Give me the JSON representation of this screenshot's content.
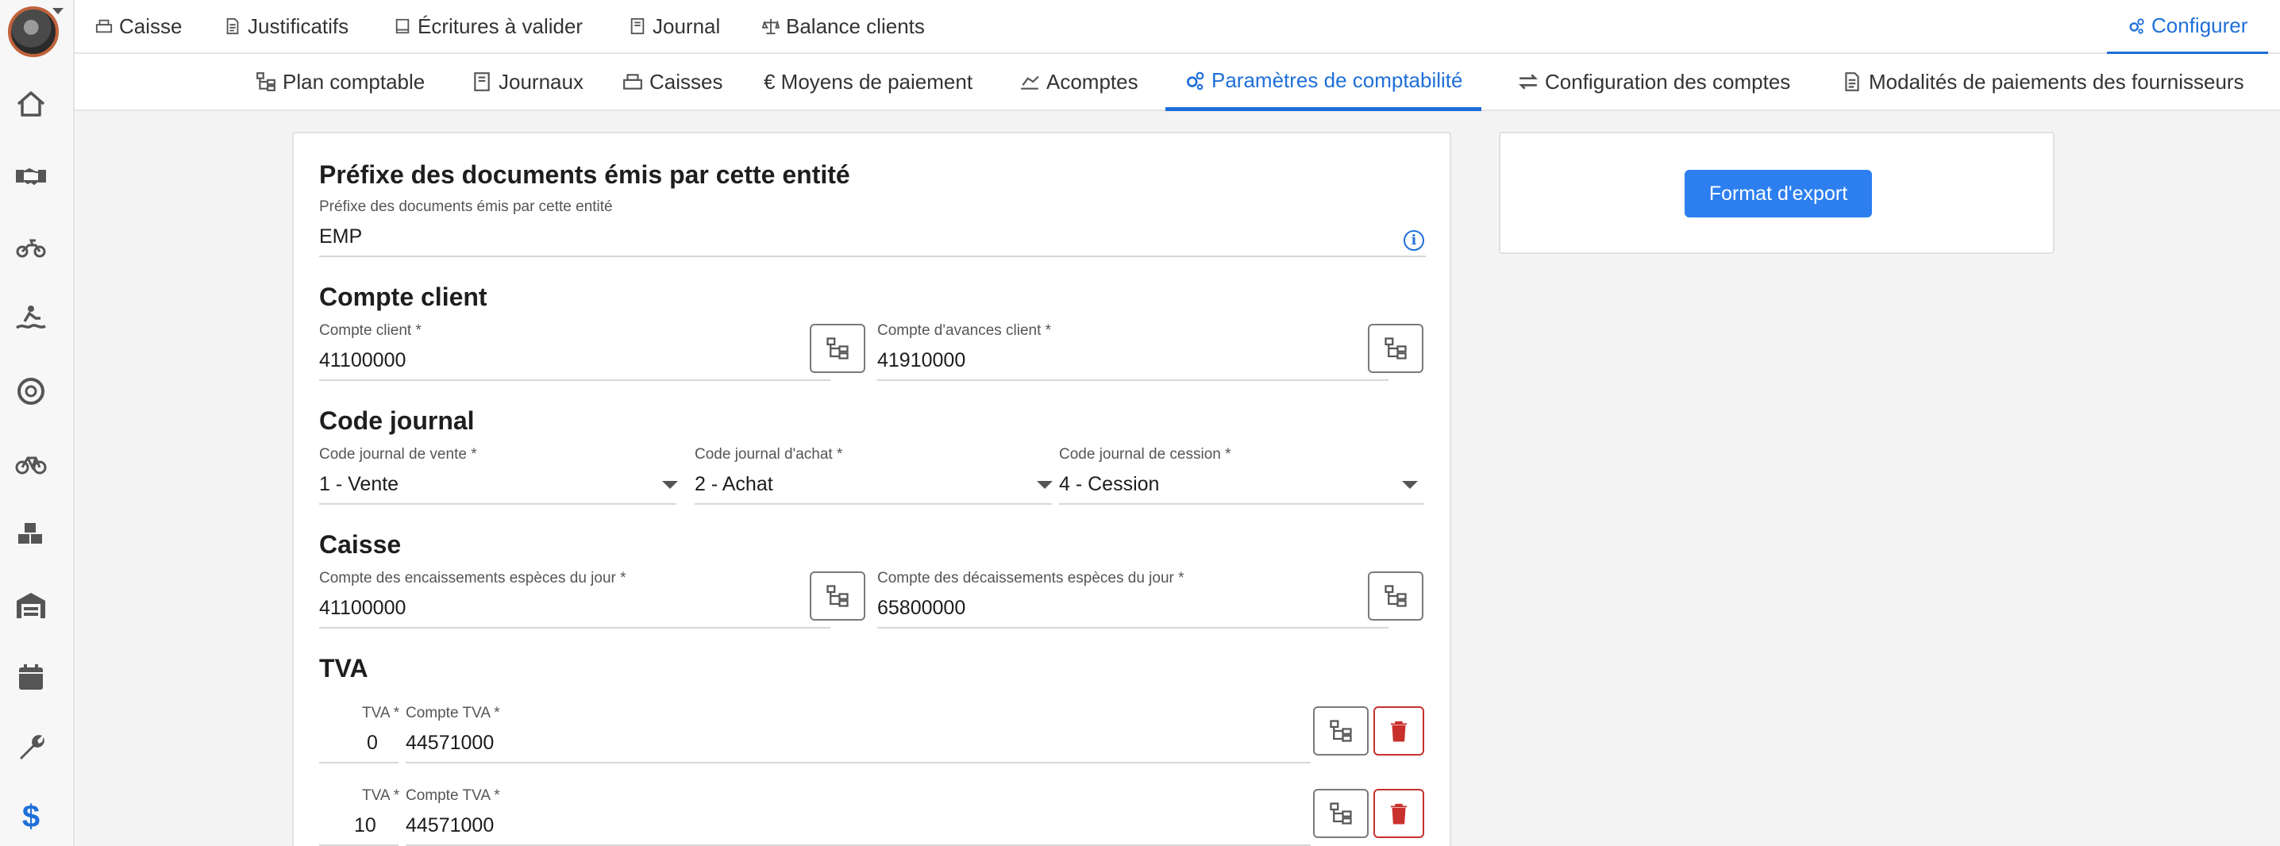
{
  "top_nav": {
    "items": [
      {
        "label": "Caisse",
        "icon": "cash-register-icon"
      },
      {
        "label": "Justificatifs",
        "icon": "document-icon"
      },
      {
        "label": "Écritures à valider",
        "icon": "book-icon"
      },
      {
        "label": "Journal",
        "icon": "journal-icon"
      },
      {
        "label": "Balance clients",
        "icon": "scale-icon"
      }
    ],
    "active": {
      "label": "Configurer",
      "icon": "gears-icon"
    }
  },
  "sub_nav": {
    "items": [
      {
        "label": "Plan comptable",
        "icon": "tree-icon"
      },
      {
        "label": "Journaux",
        "icon": "journal-icon"
      },
      {
        "label": "Caisses",
        "icon": "cash-register-icon"
      },
      {
        "label": "€ Moyens de paiement",
        "icon": "euro-icon"
      },
      {
        "label": "Acomptes",
        "icon": "payment-icon"
      },
      {
        "label": "Paramètres de comptabilité",
        "icon": "gears-icon",
        "active": true
      },
      {
        "label": "Configuration des comptes",
        "icon": "swap-icon"
      },
      {
        "label": "Modalités de paiements des fournisseurs",
        "icon": "document-icon"
      }
    ]
  },
  "sidebar": {
    "icons": [
      "home-icon",
      "handshake-icon",
      "motorcycle-icon",
      "rider-icon",
      "tire-icon",
      "bicycle-icon",
      "boxes-icon",
      "warehouse-icon",
      "calendar-icon",
      "wrench-icon",
      "dollar-icon"
    ],
    "dollar_glyph": "$"
  },
  "prefix": {
    "title": "Préfixe des documents émis par cette entité",
    "label": "Préfixe des documents émis par cette entité",
    "value": "EMP"
  },
  "compte_client": {
    "title": "Compte client",
    "client_label": "Compte client *",
    "client_value": "41100000",
    "advance_label": "Compte d'avances client *",
    "advance_value": "41910000"
  },
  "code_journal": {
    "title": "Code journal",
    "vente_label": "Code journal de vente *",
    "vente_value": "1 - Vente",
    "achat_label": "Code journal d'achat *",
    "achat_value": "2 - Achat",
    "cession_label": "Code journal de cession *",
    "cession_value": "4 - Cession"
  },
  "caisse": {
    "title": "Caisse",
    "encaissement_label": "Compte des encaissements espèces du jour *",
    "encaissement_value": "41100000",
    "decaissement_label": "Compte des décaissements espèces du jour *",
    "decaissement_value": "65800000"
  },
  "tva": {
    "title": "TVA",
    "rows": [
      {
        "rate_label": "TVA *",
        "rate": "0",
        "account_label": "Compte TVA *",
        "account": "44571000"
      },
      {
        "rate_label": "TVA *",
        "rate": "10",
        "account_label": "Compte TVA *",
        "account": "44571000"
      }
    ]
  },
  "export": {
    "button_label": "Format d'export"
  },
  "colors": {
    "accent": "#1e6fd9",
    "primary_button": "#2d7ff0",
    "danger": "#c9302c"
  }
}
